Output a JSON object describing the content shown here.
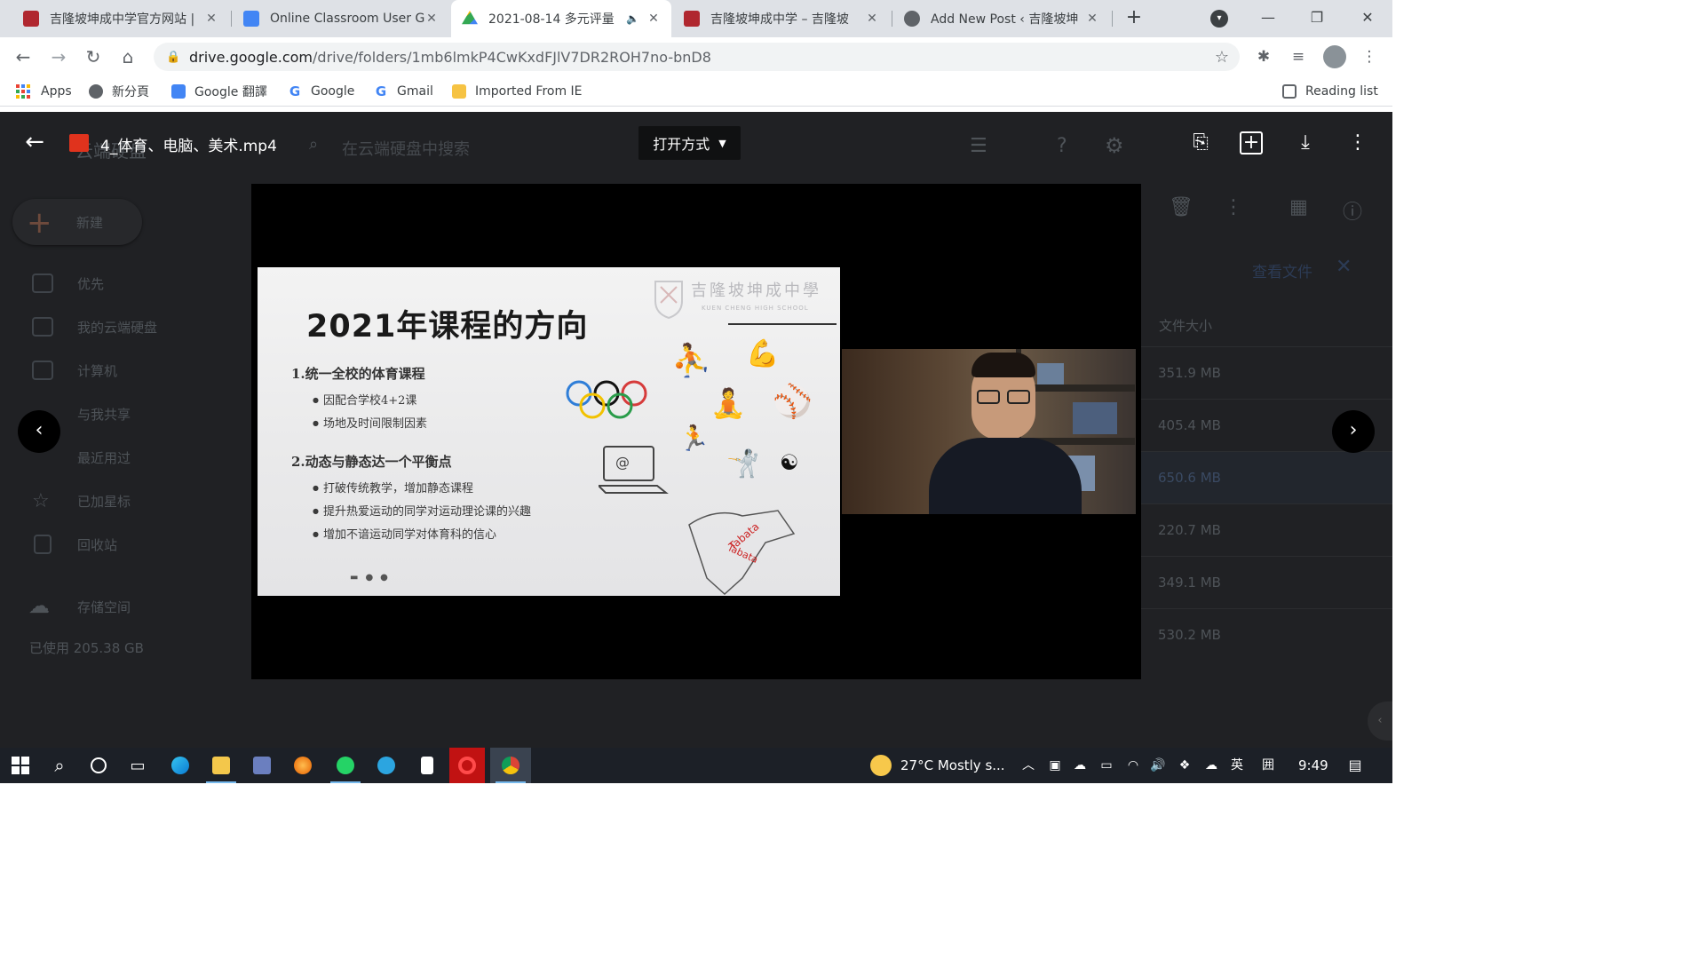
{
  "browser": {
    "tabs": [
      {
        "title": "吉隆坡坤成中学官方网站 |",
        "icon_color": "#b0272f"
      },
      {
        "title": "Online Classroom User Gu",
        "icon_color": "#4285f4"
      },
      {
        "title": "2021-08-14 多元评量",
        "icon_color": "#34a853"
      },
      {
        "title": "吉隆坡坤成中学 – 吉隆坡",
        "icon_color": "#b0272f"
      },
      {
        "title": "Add New Post ‹ 吉隆坡坤",
        "icon_color": "#5f6368"
      }
    ],
    "url_host": "drive.google.com",
    "url_path": "/drive/folders/1mb6lmkP4CwKxdFJlV7DR2ROH7no-bnD8",
    "bookmarks": [
      "Apps",
      "新分頁",
      "Google 翻譯",
      "Google",
      "Gmail",
      "Imported From IE"
    ],
    "reading_list": "Reading list"
  },
  "drive": {
    "app_name": "云端硬盘",
    "search_placeholder": "在云端硬盘中搜索",
    "new_label": "新建",
    "nav": [
      "优先",
      "我的云端硬盘",
      "计算机",
      "与我共享",
      "最近用过",
      "已加星标",
      "回收站"
    ],
    "storage_label": "存储空间",
    "storage_used": "已使用 205.38 GB",
    "view_file": "查看文件",
    "size_header": "文件大小",
    "sizes": [
      "351.9 MB",
      "405.4 MB",
      "650.6 MB",
      "220.7 MB",
      "349.1 MB",
      "530.2 MB"
    ]
  },
  "viewer": {
    "file_name": "4_体育、电脑、美术.mp4",
    "open_with": "打开方式"
  },
  "slide": {
    "title": "2021年课程的方向",
    "school_cn": "吉隆坡坤成中學",
    "school_en": "KUEN CHENG HIGH SCHOOL",
    "heading1": "1.统一全校的体育课程",
    "bullets1": [
      "因配合学校4+2课",
      "场地及时间限制因素"
    ],
    "heading2": "2.动态与静态达一个平衡点",
    "bullets2": [
      "打破传统教学，增加静态课程",
      "提升热爱运动的同学对运动理论课的兴趣",
      "增加不谙运动同学对体育科的信心"
    ],
    "tabata": "Tabata",
    "laptop_at": "@"
  },
  "taskbar": {
    "weather": "27°C  Mostly s...",
    "ime": "英",
    "time": "9:49"
  }
}
